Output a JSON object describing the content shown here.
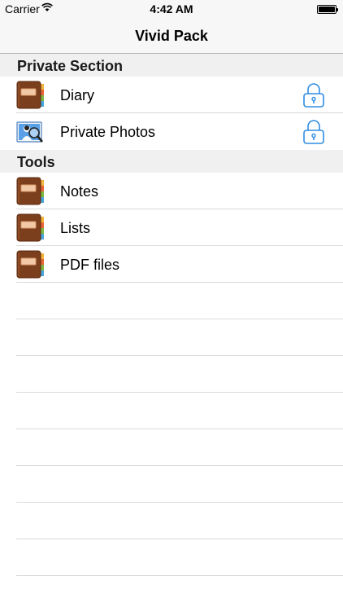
{
  "status_bar": {
    "carrier": "Carrier",
    "time": "4:42 AM"
  },
  "nav": {
    "title": "Vivid Pack"
  },
  "sections": [
    {
      "title": "Private Section",
      "items": [
        {
          "label": "Diary",
          "icon": "diary-book-icon",
          "locked": true
        },
        {
          "label": "Private Photos",
          "icon": "photo-magnifier-icon",
          "locked": true
        }
      ]
    },
    {
      "title": "Tools",
      "items": [
        {
          "label": "Notes",
          "icon": "diary-book-icon",
          "locked": false
        },
        {
          "label": "Lists",
          "icon": "diary-book-icon",
          "locked": false
        },
        {
          "label": "PDF files",
          "icon": "diary-book-icon",
          "locked": false
        }
      ]
    }
  ],
  "colors": {
    "lock_blue": "#2f8de4",
    "book_brown": "#7b3f1d"
  }
}
